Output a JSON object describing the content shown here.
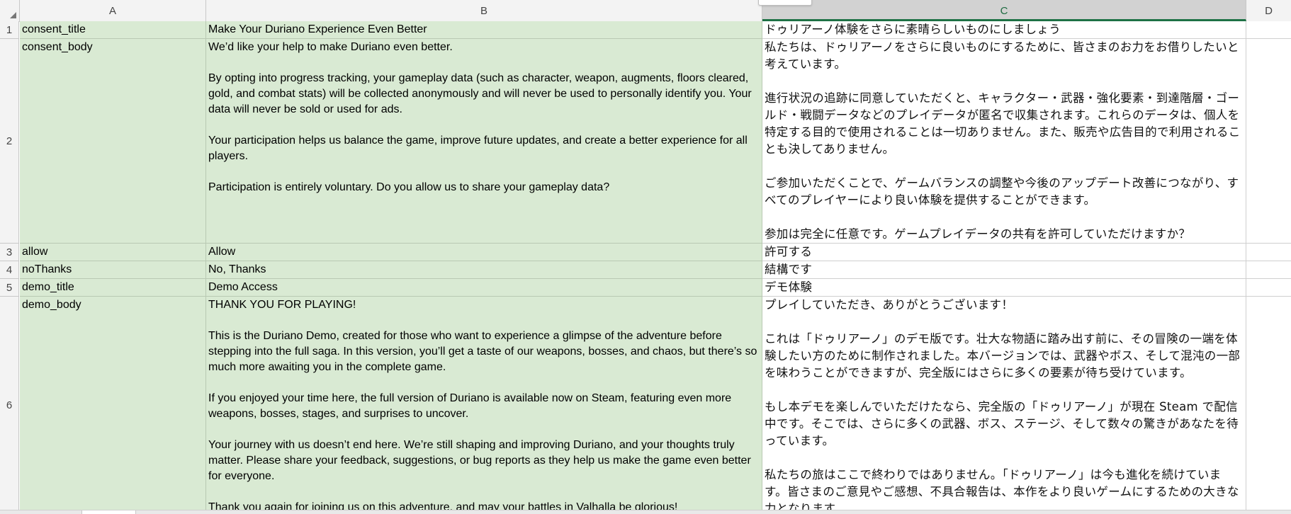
{
  "columns": [
    "A",
    "B",
    "C",
    "D"
  ],
  "selected_column": "C",
  "rows": [
    {
      "num": "1",
      "key": "consent_title",
      "en": "Make Your Duriano Experience Even Better",
      "ja": "ドゥリアーノ体験をさらに素晴らしいものにしましょう"
    },
    {
      "num": "2",
      "key": "consent_body",
      "en": "We’d like your help to make Duriano even better.\n\nBy opting into progress tracking, your gameplay data (such as character, weapon, augments, floors cleared, gold, and combat stats) will be collected anonymously and will never be used to personally identify you. Your data will never be sold or used for ads.\n\nYour participation helps us balance the game, improve future updates, and create a better experience for all players.\n\nParticipation is entirely voluntary. Do you allow us to share your gameplay data?",
      "ja": "私たちは、ドゥリアーノをさらに良いものにするために、皆さまのお力をお借りしたいと考えています。\n\n進行状況の追跡に同意していただくと、キャラクター・武器・強化要素・到達階層・ゴールド・戦闘データなどのプレイデータが匿名で収集されます。これらのデータは、個人を特定する目的で使用されることは一切ありません。また、販売や広告目的で利用されることも決してありません。\n\nご参加いただくことで、ゲームバランスの調整や今後のアップデート改善につながり、すべてのプレイヤーにより良い体験を提供することができます。\n\n参加は完全に任意です。ゲームプレイデータの共有を許可していただけますか？"
    },
    {
      "num": "3",
      "key": "allow",
      "en": "Allow",
      "ja": "許可する"
    },
    {
      "num": "4",
      "key": "noThanks",
      "en": "No, Thanks",
      "ja": "結構です"
    },
    {
      "num": "5",
      "key": "demo_title",
      "en": "Demo Access",
      "ja": "デモ体験"
    },
    {
      "num": "6",
      "key": "demo_body",
      "en": "THANK YOU FOR PLAYING!\n\nThis is the Duriano Demo, created for those who want to experience a glimpse of the adventure before stepping into the full saga. In this version, you’ll get a taste of our weapons, bosses, and chaos, but there’s so much more awaiting you in the complete game.\n\nIf you enjoyed your time here, the full version of Duriano is available now on Steam, featuring even more weapons, bosses, stages, and surprises to uncover.\n\nYour journey with us doesn’t end here. We’re still shaping and improving Duriano, and your thoughts truly matter. Please share your feedback, suggestions, or bug reports as they help us make the game even better for everyone.\n\nThank you again for joining us on this adventure, and may your battles in Valhalla be glorious!",
      "ja": "プレイしていただき、ありがとうございます！\n\nこれは「ドゥリアーノ」のデモ版です。壮大な物語に踏み出す前に、その冒険の一端を体験したい方のために制作されました。本バージョンでは、武器やボス、そして混沌の一部を味わうことができますが、完全版にはさらに多くの要素が待ち受けています。\n\nもし本デモを楽しんでいただけたなら、完全版の「ドゥリアーノ」が現在 Steam で配信中です。そこでは、さらに多くの武器、ボス、ステージ、そして数々の驚きがあなたを待っています。\n\n私たちの旅はここで終わりではありません。「ドゥリアーノ」は今も進化を続けています。皆さまのご意見やご感想、不具合報告は、本作をより良いゲームにするための大きな力となります。"
    }
  ],
  "colors": {
    "cell_fill": "#d9ead3",
    "selected_header_underline": "#1e7145",
    "header_bg": "#f3f3f3"
  }
}
